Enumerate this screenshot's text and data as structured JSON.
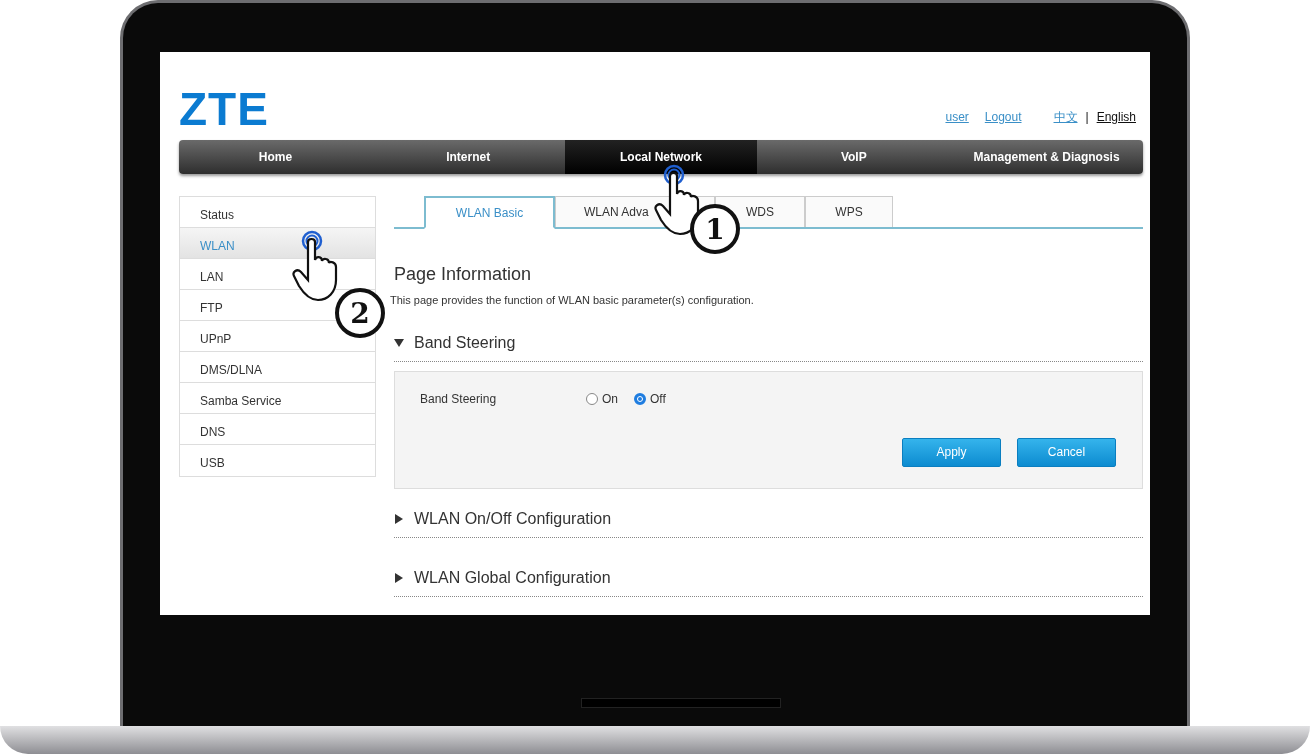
{
  "header": {
    "logo": "ZTE",
    "user_links": [
      "user",
      "Logout"
    ],
    "languages": [
      {
        "label": "中文",
        "selected": false
      },
      {
        "label": "English",
        "selected": true
      }
    ],
    "language_separator": "|"
  },
  "nav": [
    {
      "label": "Home",
      "selected": false
    },
    {
      "label": "Internet",
      "selected": false
    },
    {
      "label": "Local Network",
      "selected": true
    },
    {
      "label": "VoIP",
      "selected": false
    },
    {
      "label": "Management & Diagnosis",
      "selected": false
    }
  ],
  "sidebar": {
    "items": [
      {
        "label": "Status",
        "selected": false
      },
      {
        "label": "WLAN",
        "selected": true
      },
      {
        "label": "LAN",
        "selected": false
      },
      {
        "label": "FTP",
        "selected": false
      },
      {
        "label": "UPnP",
        "selected": false
      },
      {
        "label": "DMS/DLNA",
        "selected": false
      },
      {
        "label": "Samba Service",
        "selected": false
      },
      {
        "label": "DNS",
        "selected": false
      },
      {
        "label": "USB",
        "selected": false
      }
    ]
  },
  "tabs": [
    {
      "label": "WLAN Basic",
      "selected": true
    },
    {
      "label": "WLAN Adva",
      "selected": false
    },
    {
      "label": "WDS",
      "selected": false
    },
    {
      "label": "WPS",
      "selected": false
    }
  ],
  "page_title": "Page Information",
  "page_description": "This page provides the function of WLAN basic parameter(s) configuration.",
  "sections": [
    {
      "title": "Band Steering",
      "expanded": true,
      "fields": [
        {
          "label": "Band Steering",
          "options": [
            {
              "label": "On",
              "selected": false
            },
            {
              "label": "Off",
              "selected": true
            }
          ]
        }
      ],
      "buttons": [
        "Apply",
        "Cancel"
      ]
    },
    {
      "title": "WLAN On/Off Configuration",
      "expanded": false
    },
    {
      "title": "WLAN Global Configuration",
      "expanded": false
    }
  ],
  "annotations": [
    {
      "number": "1"
    },
    {
      "number": "2"
    }
  ]
}
